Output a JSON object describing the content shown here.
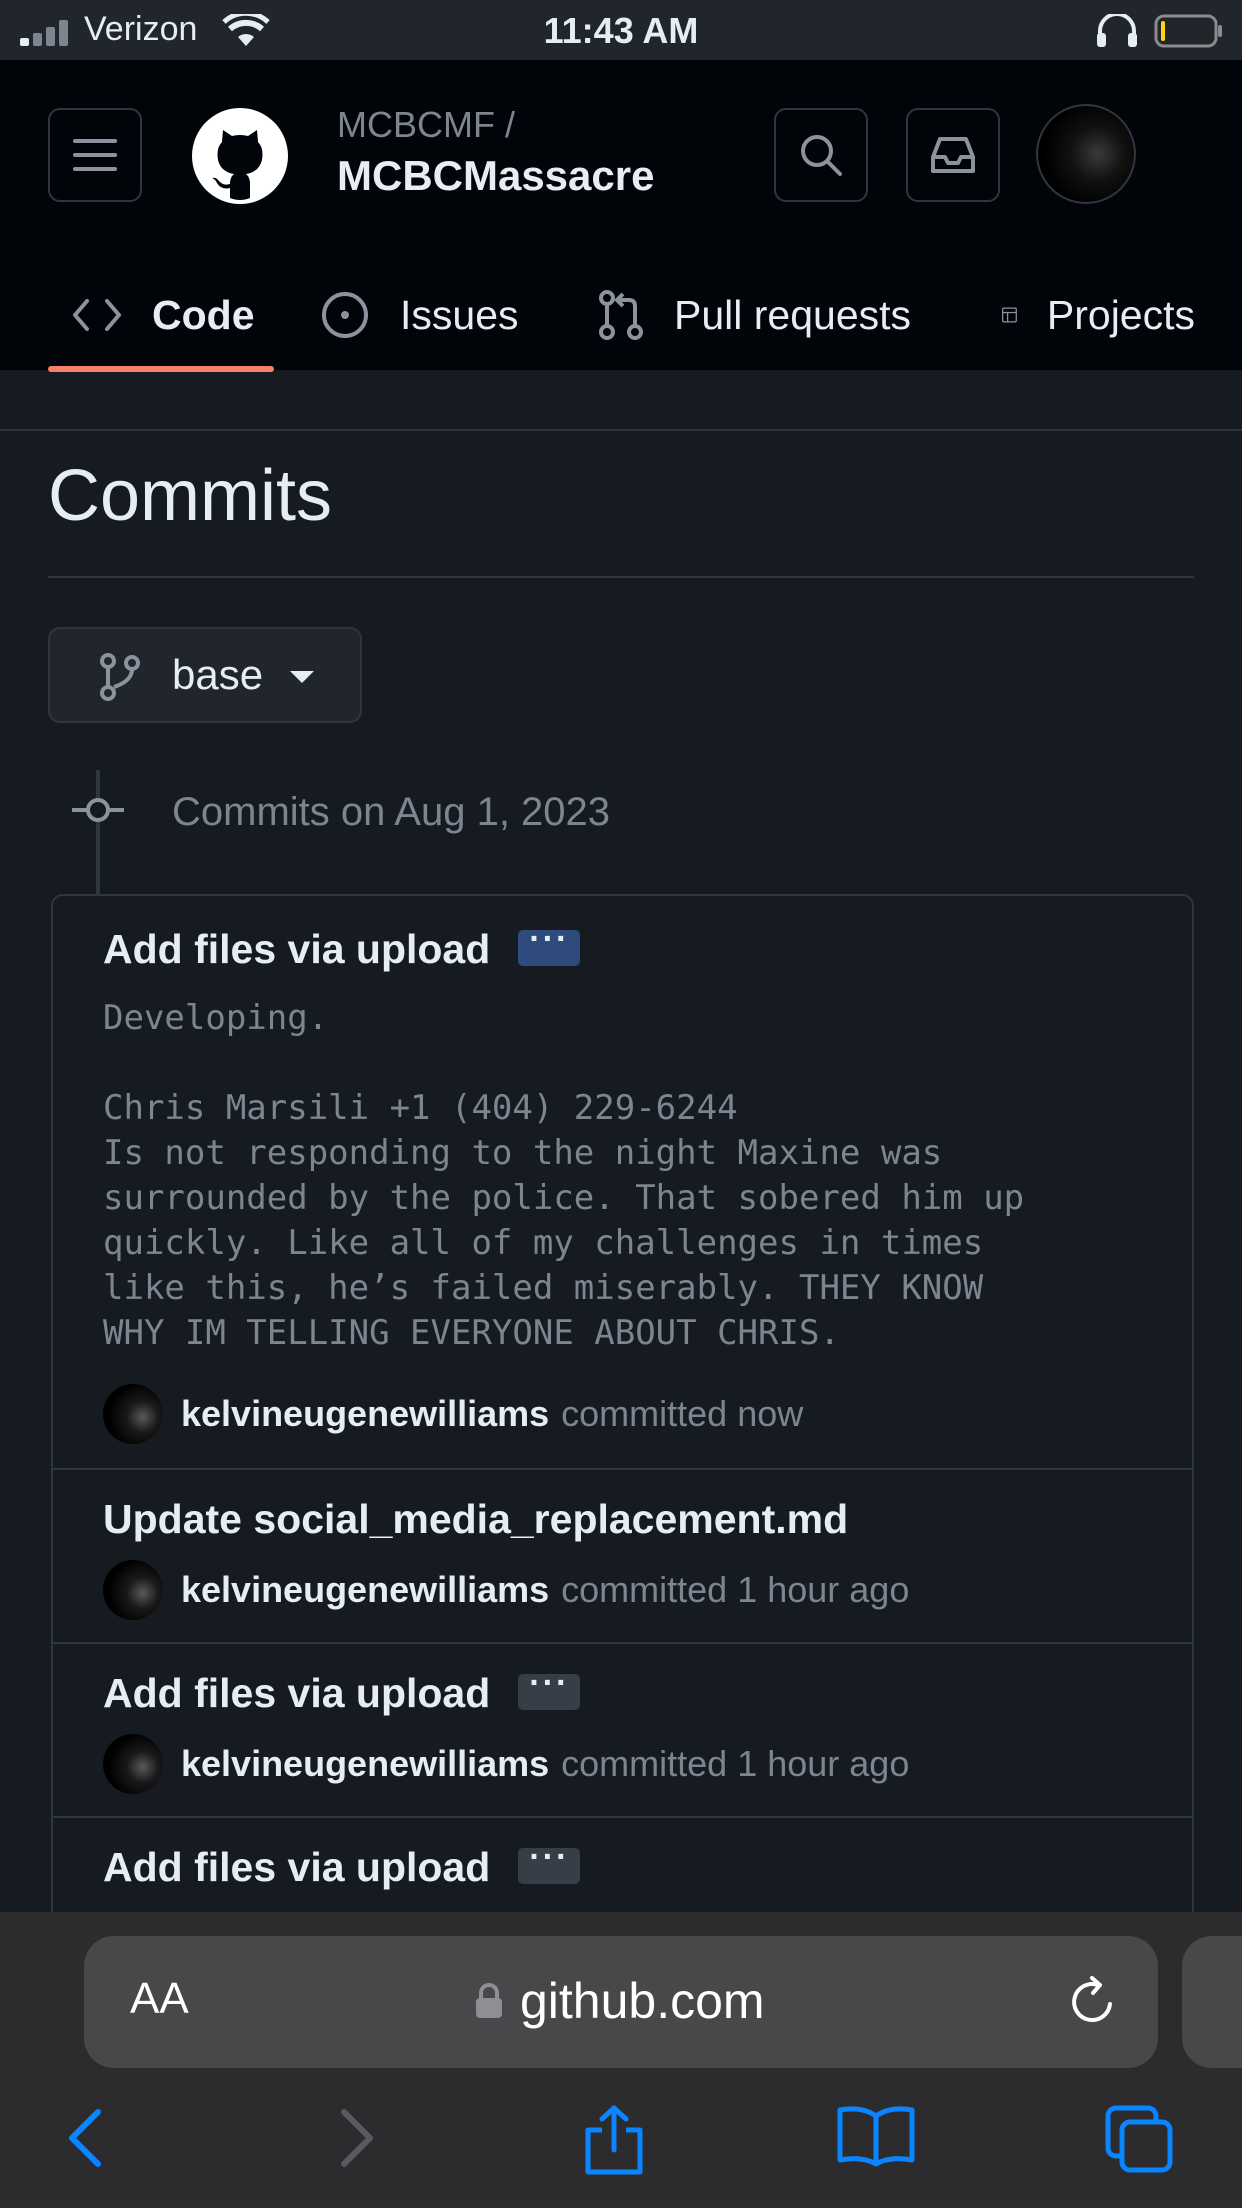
{
  "status_bar": {
    "carrier": "Verizon",
    "time": "11:43 AM",
    "icons": [
      "signal-icon",
      "wifi-icon",
      "headphones-icon",
      "battery-icon"
    ]
  },
  "header": {
    "owner": "MCBCMF /",
    "repo": "MCBCMassacre",
    "icons": [
      "menu-icon",
      "github-logo",
      "search-icon",
      "inbox-icon",
      "avatar"
    ]
  },
  "tabs": [
    {
      "label": "Code",
      "icon": "code-icon",
      "selected": true
    },
    {
      "label": "Issues",
      "icon": "issue-icon"
    },
    {
      "label": "Pull requests",
      "icon": "pull-request-icon"
    },
    {
      "label": "Projects",
      "icon": "table-icon"
    }
  ],
  "page": {
    "title": "Commits",
    "branch": "base",
    "group_date": "Commits on Aug 1, 2023"
  },
  "commits": [
    {
      "title": "Add files via upload",
      "ellipsis": "···",
      "body": "Developing.\n\nChris Marsili +1 (404) 229-6244\nIs not responding to the night Maxine was\nsurrounded by the police. That sobered him up\nquickly. Like all of my challenges in times\nlike this, he’s failed miserably. THEY KNOW\nWHY IM TELLING EVERYONE ABOUT CHRIS.",
      "author": "kelvineugenewilliams",
      "time": "committed now"
    },
    {
      "title": "Update social_media_replacement.md",
      "author": "kelvineugenewilliams",
      "time": "committed 1 hour ago"
    },
    {
      "title": "Add files via upload",
      "ellipsis": "···",
      "author": "kelvineugenewilliams",
      "time": "committed 1 hour ago"
    },
    {
      "title": "Add files via upload",
      "ellipsis": "···"
    }
  ],
  "safari": {
    "text_size_label": "AA",
    "url": "github.com",
    "icons": [
      "lock-icon",
      "reload-icon",
      "back-icon",
      "forward-icon",
      "share-icon",
      "bookmarks-icon",
      "tabs-icon"
    ]
  },
  "colors": {
    "background": "#161b22",
    "header": "#010409",
    "accent_underline": "#f78166",
    "muted_text": "#7d8590",
    "safari_blue": "#0a84ff"
  }
}
